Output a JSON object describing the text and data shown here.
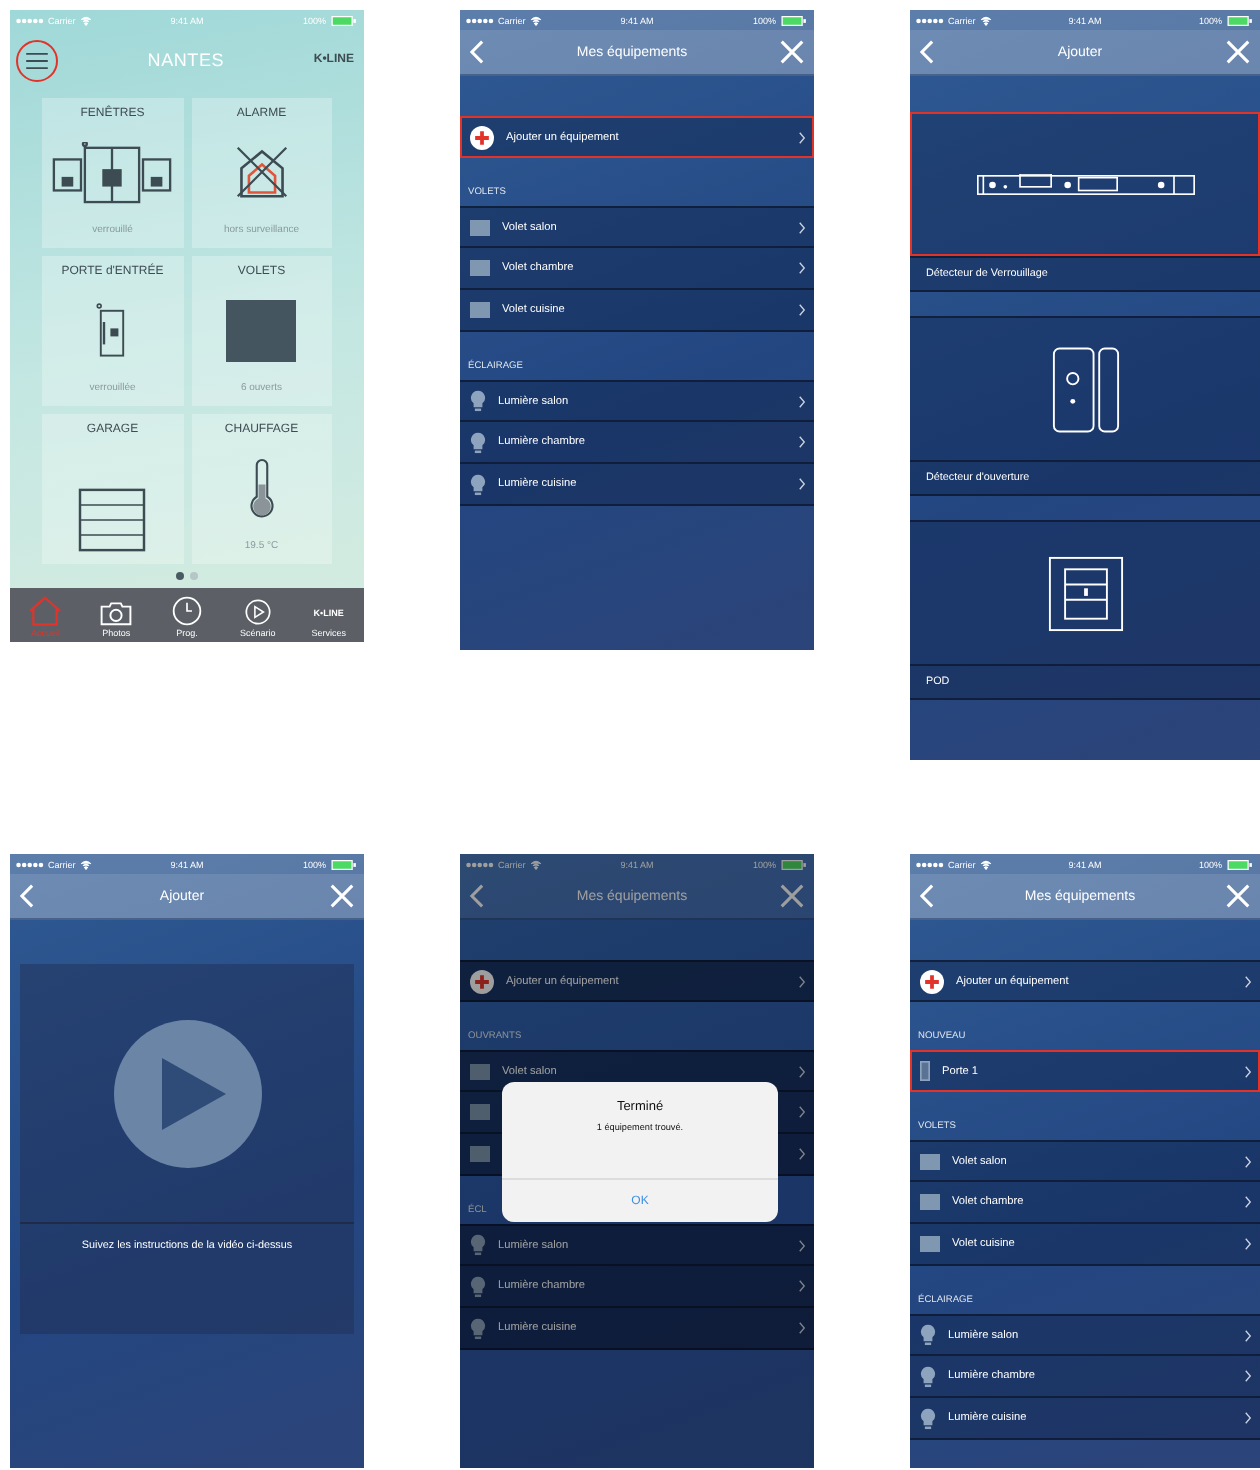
{
  "screens": [
    {
      "kind": "home",
      "status_bar": {
        "carrier": "Carrier",
        "time": "9:41 AM",
        "battery": "100%"
      },
      "menu_highlighted": true,
      "title": "NANTES",
      "brand": "K•LINE",
      "tiles": [
        {
          "kind": "windows",
          "title": "FENÊTRES",
          "status": "verrouillé"
        },
        {
          "kind": "alarm",
          "title": "ALARME",
          "status": "hors surveillance"
        },
        {
          "kind": "door",
          "title": "PORTE d'ENTRÉE",
          "status": "verrouillée"
        },
        {
          "kind": "shutters",
          "title": "VOLETS",
          "status": "6 ouverts"
        },
        {
          "kind": "garage",
          "title": "GARAGE"
        },
        {
          "kind": "heating",
          "title": "CHAUFFAGE",
          "status": "19.5 °C"
        }
      ],
      "page_dots": [
        {
          "selected": true
        },
        {
          "selected": false
        }
      ],
      "tabs": [
        {
          "kind": "home",
          "label": "Accueil",
          "selected": true
        },
        {
          "kind": "camera",
          "label": "Photos",
          "selected": false
        },
        {
          "kind": "clock",
          "label": "Prog.",
          "selected": false
        },
        {
          "kind": "play",
          "label": "Scénario",
          "selected": false
        },
        {
          "kind": "brand",
          "logo": "K•LINE",
          "label": "Services",
          "selected": false
        }
      ]
    },
    {
      "kind": "list",
      "status_bar": {
        "carrier": "Carrier",
        "time": "9:41 AM",
        "battery": "100%"
      },
      "title": "Mes équipements",
      "add_row": {
        "label": "Ajouter un équipement",
        "highlighted": true
      },
      "sections": [
        {
          "title": "VOLETS",
          "items": [
            {
              "kind": "shutter",
              "label": "Volet salon",
              "highlighted": false
            },
            {
              "kind": "shutter",
              "label": "Volet chambre",
              "highlighted": false
            },
            {
              "kind": "shutter",
              "label": "Volet cuisine",
              "highlighted": false
            }
          ]
        },
        {
          "title": "ÉCLAIRAGE",
          "items": [
            {
              "kind": "bulb",
              "label": "Lumière salon",
              "highlighted": false
            },
            {
              "kind": "bulb",
              "label": "Lumière chambre",
              "highlighted": false
            },
            {
              "kind": "bulb",
              "label": "Lumière cuisine",
              "highlighted": false
            }
          ]
        }
      ]
    },
    {
      "kind": "catalog",
      "status_bar": {
        "carrier": "Carrier",
        "time": "9:41 AM",
        "battery": "100%"
      },
      "title": "Ajouter",
      "items": [
        {
          "kind": "lock_detector",
          "label": "Détecteur de Verrouillage",
          "highlighted": true
        },
        {
          "kind": "opening_detector",
          "label": "Détecteur d'ouverture",
          "highlighted": false
        },
        {
          "kind": "pod",
          "label": "POD",
          "highlighted": false
        }
      ]
    },
    {
      "kind": "video",
      "status_bar": {
        "carrier": "Carrier",
        "time": "9:41 AM",
        "battery": "100%"
      },
      "title": "Ajouter",
      "caption": "Suivez les instructions de la vidéo ci-dessus"
    },
    {
      "kind": "list",
      "dimmed": true,
      "status_bar": {
        "carrier": "Carrier",
        "time": "9:41 AM",
        "battery": "100%"
      },
      "title": "Mes équipements",
      "add_row": {
        "label": "Ajouter un équipement",
        "highlighted": false
      },
      "sections": [
        {
          "title": "OUVRANTS",
          "items": [
            {
              "kind": "shutter",
              "label": "Volet salon",
              "highlighted": false
            },
            {
              "kind": "shutter",
              "highlighted": false
            },
            {
              "kind": "shutter",
              "highlighted": false
            }
          ]
        },
        {
          "title": "ÉCL",
          "items": [
            {
              "kind": "bulb",
              "label": "Lumière salon",
              "highlighted": false
            },
            {
              "kind": "bulb",
              "label": "Lumière chambre",
              "highlighted": false
            },
            {
              "kind": "bulb",
              "label": "Lumière cuisine",
              "highlighted": false
            }
          ]
        }
      ],
      "dialog": {
        "title": "Terminé",
        "message": "1 équipement trouvé.",
        "button": "OK"
      }
    },
    {
      "kind": "list",
      "status_bar": {
        "carrier": "Carrier",
        "time": "9:41 AM",
        "battery": "100%"
      },
      "title": "Mes équipements",
      "add_row": {
        "label": "Ajouter un équipement",
        "highlighted": false
      },
      "sections": [
        {
          "title": "NOUVEAU",
          "items": [
            {
              "kind": "door",
              "label": "Porte 1",
              "highlighted": true
            }
          ]
        },
        {
          "title": "VOLETS",
          "items": [
            {
              "kind": "shutter",
              "label": "Volet salon",
              "highlighted": false
            },
            {
              "kind": "shutter",
              "label": "Volet chambre",
              "highlighted": false
            },
            {
              "kind": "shutter",
              "label": "Volet cuisine",
              "highlighted": false
            }
          ]
        },
        {
          "title": "ÉCLAIRAGE",
          "items": [
            {
              "kind": "bulb",
              "label": "Lumière salon",
              "highlighted": false
            },
            {
              "kind": "bulb",
              "label": "Lumière chambre",
              "highlighted": false
            },
            {
              "kind": "bulb",
              "label": "Lumière cuisine",
              "highlighted": false
            }
          ]
        }
      ]
    }
  ]
}
